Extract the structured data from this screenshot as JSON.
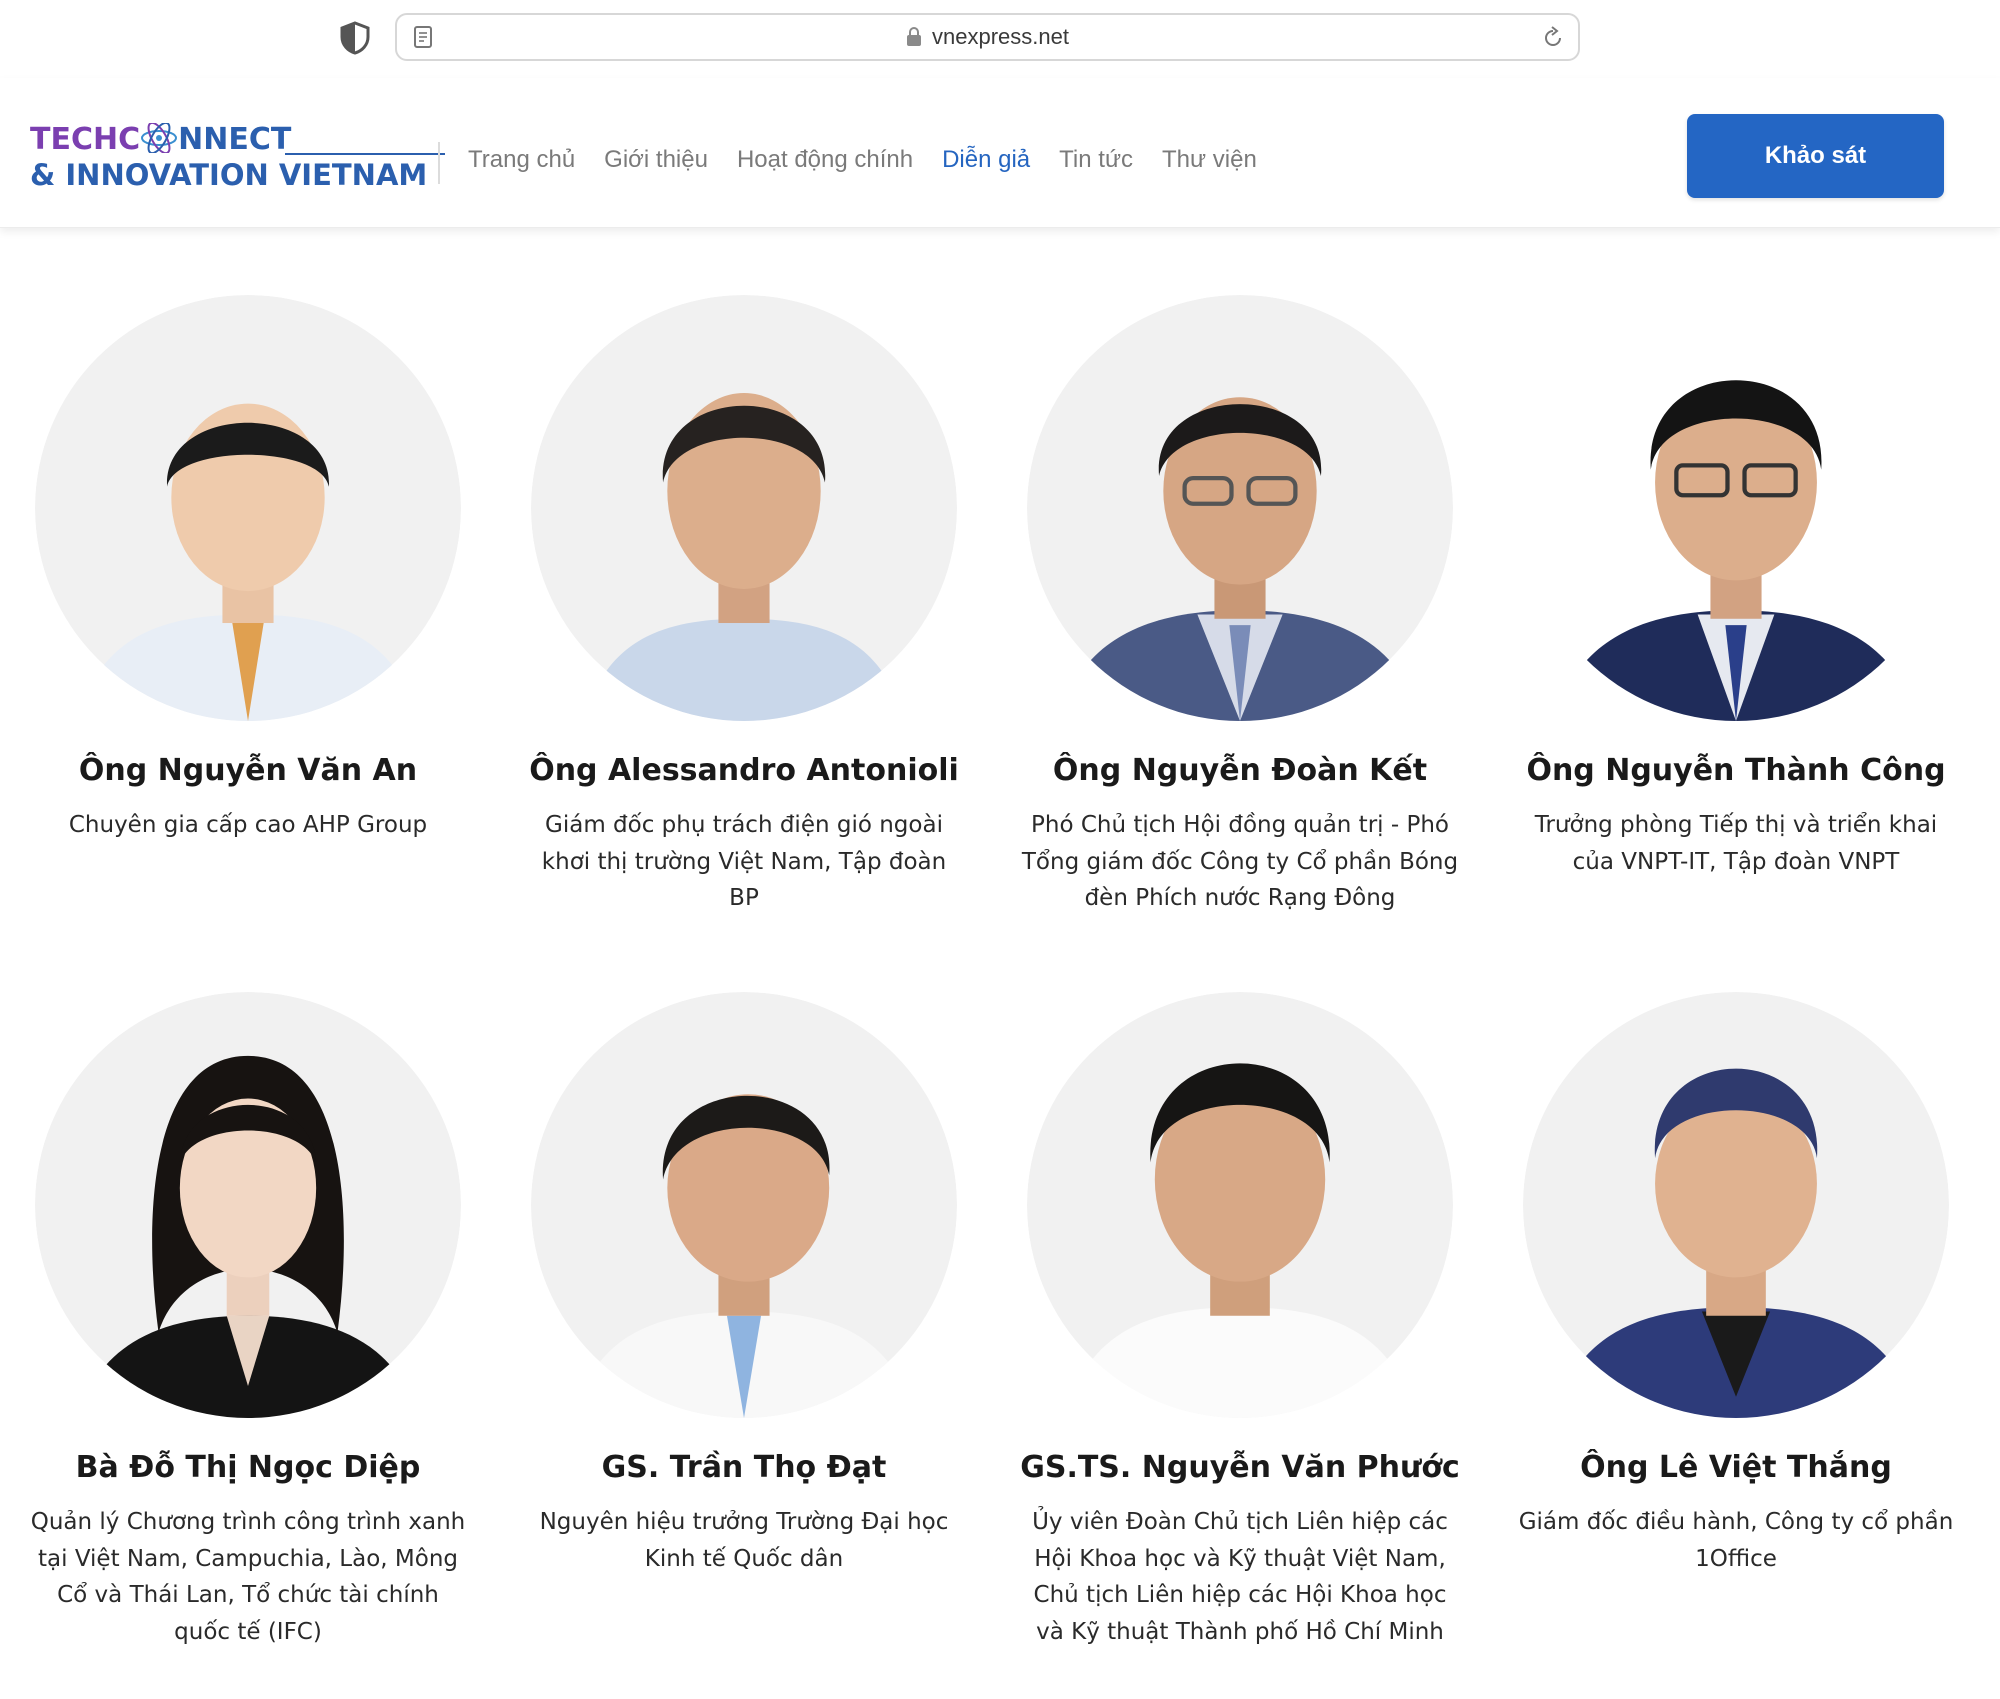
{
  "browser": {
    "url": "vnexpress.net"
  },
  "header": {
    "logo": {
      "line1": "TECHC",
      "line1_end": "NNECT",
      "line2": "& INNOVATION VIETNAM"
    },
    "nav": [
      {
        "label": "Trang chủ",
        "active": false
      },
      {
        "label": "Giới thiệu",
        "active": false
      },
      {
        "label": "Hoạt động chính",
        "active": false
      },
      {
        "label": "Diễn giả",
        "active": true
      },
      {
        "label": "Tin tức",
        "active": false
      },
      {
        "label": "Thư viện",
        "active": false
      }
    ],
    "cta_label": "Khảo sát"
  },
  "colors": {
    "accent": "#2466c4",
    "nav_active": "#2565c0",
    "logo_purple": "#7b3fb0",
    "logo_blue": "#2b5fae",
    "avatar_bg": "#f1f1f1"
  },
  "speakers": [
    {
      "name": "Ông Nguyễn Văn An",
      "title": "Chuyên gia cấp cao AHP Group",
      "photo_icon": "man-portrait-light-shirt-tie"
    },
    {
      "name": "Ông Alessandro Antonioli",
      "title": "Giám đốc phụ trách điện gió ngoài khơi thị trường Việt Nam, Tập đoàn BP",
      "photo_icon": "man-portrait-open-collar"
    },
    {
      "name": "Ông Nguyễn Đoàn Kết",
      "title": "Phó Chủ tịch Hội đồng quản trị - Phó Tổng giám đốc Công ty Cổ phần Bóng đèn Phích nước Rạng Đông",
      "photo_icon": "man-portrait-glasses-suit"
    },
    {
      "name": "Ông Nguyễn Thành Công",
      "title": "Trưởng phòng Tiếp thị và triển khai của VNPT-IT, Tập đoàn VNPT",
      "photo_icon": "man-portrait-glasses-navy-suit"
    },
    {
      "name": "Bà Đỗ Thị Ngọc Diệp",
      "title": "Quản lý Chương trình công trình xanh tại Việt Nam, Campuchia, Lào, Mông Cổ và Thái Lan, Tổ chức tài chính quốc tế (IFC)",
      "photo_icon": "woman-portrait-black-blazer"
    },
    {
      "name": "GS. Trần Thọ Đạt",
      "title": "Nguyên hiệu trưởng Trường Đại học Kinh tế Quốc dân",
      "photo_icon": "man-portrait-white-shirt-tie"
    },
    {
      "name": "GS.TS. Nguyễn Văn Phước",
      "title": "Ủy viên Đoàn Chủ tịch Liên hiệp các Hội Khoa học và Kỹ thuật Việt Nam, Chủ tịch Liên hiệp các Hội Khoa học và Kỹ thuật Thành phố Hồ Chí Minh",
      "photo_icon": "man-portrait-white-shirt"
    },
    {
      "name": "Ông Lê Việt Thắng",
      "title": "Giám đốc điều hành, Công ty cổ phần 1Office",
      "photo_icon": "man-portrait-blue-pinstripe-suit"
    }
  ]
}
